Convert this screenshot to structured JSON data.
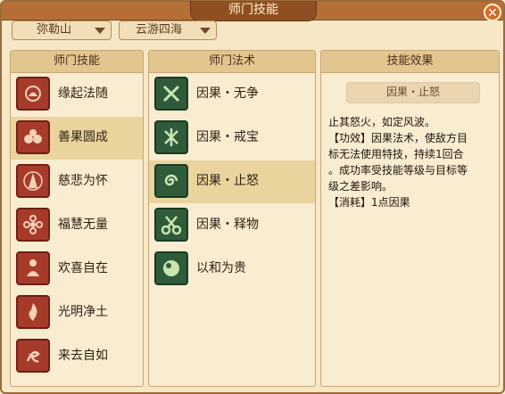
{
  "window": {
    "title": "师门技能",
    "close_label": "✕"
  },
  "dropdowns": [
    {
      "value": "弥勒山"
    },
    {
      "value": "云游四海"
    }
  ],
  "panels": {
    "skills": {
      "title": "师门技能",
      "items": [
        {
          "label": "缘起法随",
          "icon": "lotus-hand-icon",
          "selected": false
        },
        {
          "label": "善果圆成",
          "icon": "fruit-icon",
          "selected": true
        },
        {
          "label": "慈悲为怀",
          "icon": "praying-hands-icon",
          "selected": false
        },
        {
          "label": "福慧无量",
          "icon": "flower-icon",
          "selected": false
        },
        {
          "label": "欢喜自在",
          "icon": "meditating-monk-icon",
          "selected": false
        },
        {
          "label": "光明净土",
          "icon": "flame-icon",
          "selected": false
        },
        {
          "label": "来去自如",
          "icon": "scroll-icon",
          "selected": false
        }
      ]
    },
    "spells": {
      "title": "师门法术",
      "items": [
        {
          "label": "因果・无争",
          "icon": "crossed-swords-icon",
          "selected": false
        },
        {
          "label": "因果・戒宝",
          "icon": "rune-icon",
          "selected": false
        },
        {
          "label": "因果・止怒",
          "icon": "swirl-icon",
          "selected": true
        },
        {
          "label": "因果・释物",
          "icon": "scissors-icon",
          "selected": false
        },
        {
          "label": "以和为贵",
          "icon": "orb-icon",
          "selected": false
        }
      ]
    },
    "effect": {
      "title": "技能效果",
      "skill_name": "因果・止怒",
      "lines": [
        "止其怒火，如定风波。",
        "【功效】因果法术，使敌方目",
        "标无法使用特技，持续1回合",
        "。成功率受技能等级与目标等",
        "级之差影响。",
        "【消耗】1点因果"
      ]
    }
  },
  "colors": {
    "accent": "#b56f36",
    "selected_row": "#ead49e",
    "skill_icon_bg": "#a73b2b",
    "spell_icon_bg": "#2f5b3b"
  }
}
